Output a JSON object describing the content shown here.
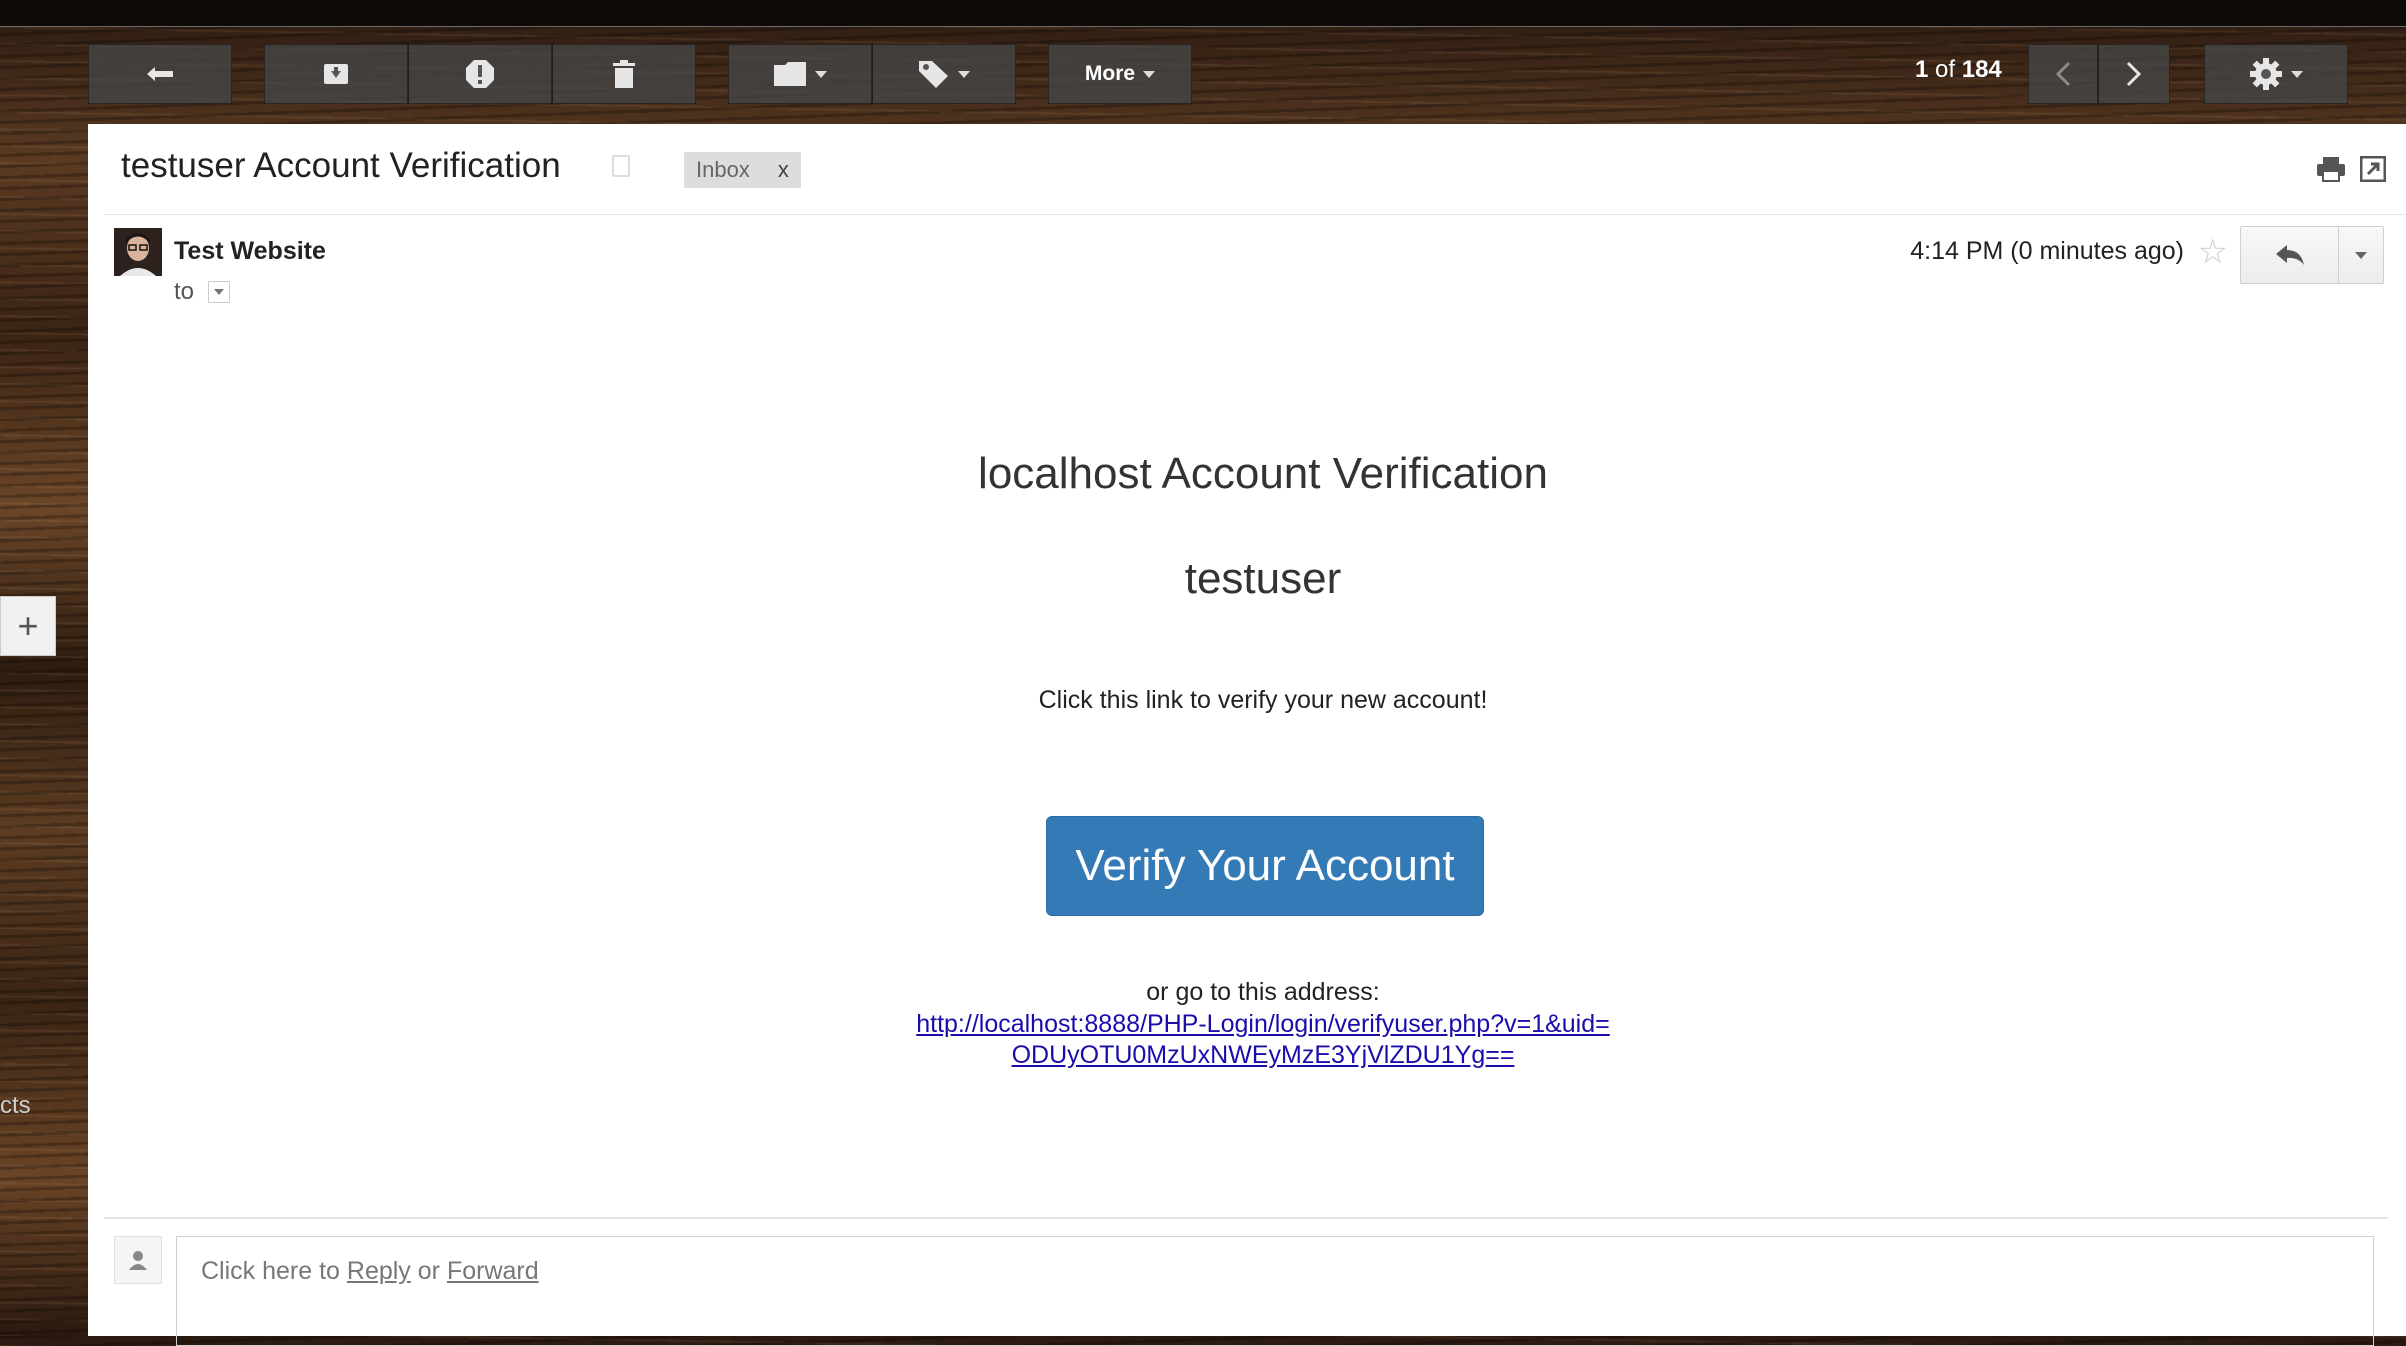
{
  "toolbar": {
    "more_label": "More",
    "pager_current": "1",
    "pager_of": "of",
    "pager_total": "184"
  },
  "email": {
    "subject": "testuser Account Verification",
    "label_chip": "Inbox",
    "label_remove": "x",
    "sender": "Test Website",
    "to_label": "to",
    "time": "4:14 PM (0 minutes ago)",
    "star": "☆"
  },
  "body": {
    "heading": "localhost Account Verification",
    "username": "testuser",
    "message": "Click this link to verify your new account!",
    "button_label": "Verify Your Account",
    "alt_text": "or go to this address:",
    "link_line1": "http://localhost:8888/PHP-Login/login/verifyuser.php?v=1&uid=",
    "link_line2": "ODUyOTU0MzUxNWEyMzE3YjVlZDU1Yg=="
  },
  "reply": {
    "prefix": "Click here to ",
    "reply_link": "Reply",
    "or": " or ",
    "forward_link": "Forward"
  },
  "sidebar": {
    "plus": "+",
    "partial_text": "cts"
  },
  "colors": {
    "accent_button": "#337ab7",
    "link": "#1a0dab"
  }
}
